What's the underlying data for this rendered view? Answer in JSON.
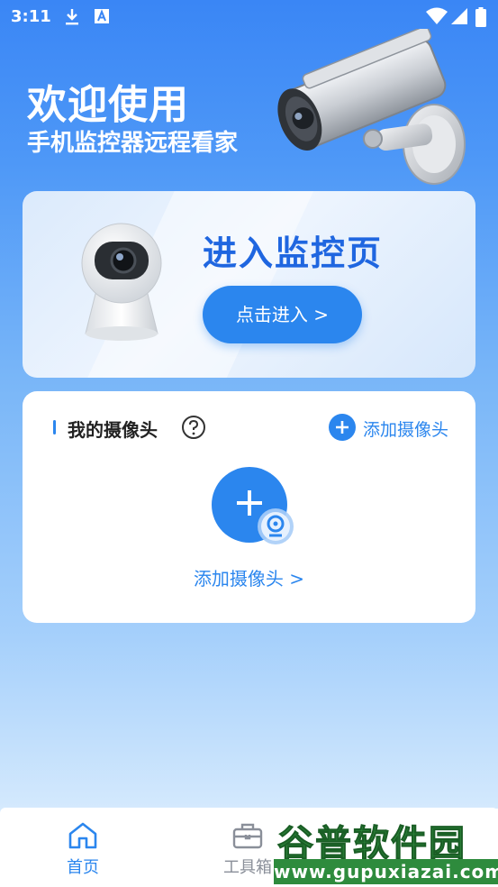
{
  "status_bar": {
    "time": "3:11",
    "icons": [
      "download-icon",
      "font-icon",
      "wifi-icon",
      "signal-icon",
      "battery-icon"
    ]
  },
  "header": {
    "title": "欢迎使用",
    "subtitle": "手机监控器远程看家"
  },
  "monitor_card": {
    "title": "进入监控页",
    "button_label": "点击进入 >"
  },
  "camera_section": {
    "title": "我的摄像头",
    "add_label": "添加摄像头",
    "add_camera_label": "添加摄像头 >"
  },
  "bottom_nav": {
    "items": [
      {
        "label": "首页",
        "icon": "home-icon",
        "active": true
      },
      {
        "label": "工具箱",
        "icon": "toolbox-icon",
        "active": false
      }
    ]
  },
  "watermark": {
    "title": "谷普软件园",
    "url": "www.gupuxiazai.com"
  },
  "colors": {
    "accent": "#2b86ee",
    "title_blue": "#1f66e0",
    "watermark_green": "#2e8b3d"
  }
}
